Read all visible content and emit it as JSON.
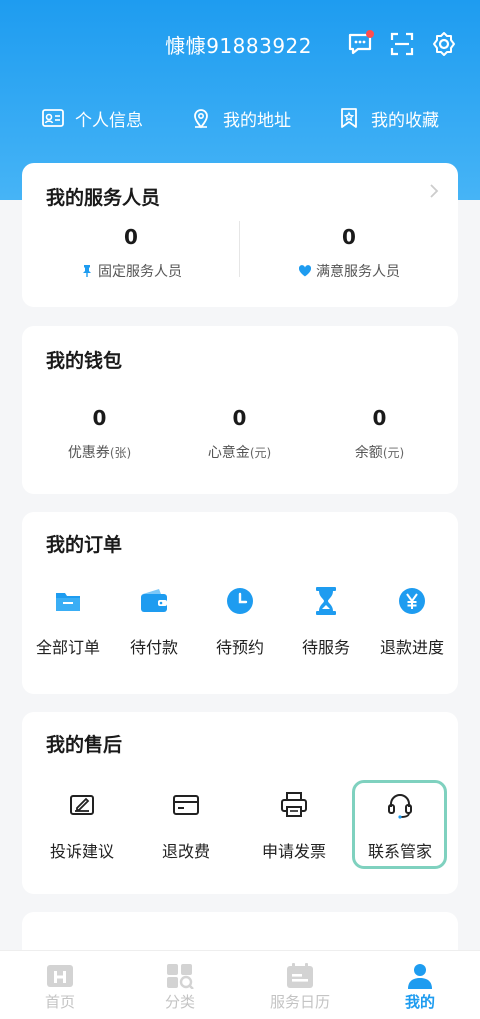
{
  "user": {
    "name": "慷慷91883922"
  },
  "topbar": {
    "message_icon": "message-icon",
    "scan_icon": "scan-icon",
    "settings_icon": "gear-icon"
  },
  "quick_links": [
    {
      "label": "个人信息",
      "icon": "id-card-icon"
    },
    {
      "label": "我的地址",
      "icon": "location-pin-icon"
    },
    {
      "label": "我的收藏",
      "icon": "bookmark-star-icon"
    }
  ],
  "staff": {
    "title": "我的服务人员",
    "fixed": {
      "count": "0",
      "label": "固定服务人员"
    },
    "satisfied": {
      "count": "0",
      "label": "满意服务人员"
    }
  },
  "wallet": {
    "title": "我的钱包",
    "items": [
      {
        "value": "0",
        "label": "优惠券",
        "unit": "(张)"
      },
      {
        "value": "0",
        "label": "心意金",
        "unit": "(元)"
      },
      {
        "value": "0",
        "label": "余额",
        "unit": "(元)"
      }
    ]
  },
  "orders": {
    "title": "我的订单",
    "items": [
      {
        "label": "全部订单",
        "icon": "folder-icon"
      },
      {
        "label": "待付款",
        "icon": "wallet-icon"
      },
      {
        "label": "待预约",
        "icon": "clock-icon"
      },
      {
        "label": "待服务",
        "icon": "hourglass-icon"
      },
      {
        "label": "退款进度",
        "icon": "yuan-icon"
      }
    ]
  },
  "aftersale": {
    "title": "我的售后",
    "items": [
      {
        "label": "投诉建议",
        "icon": "edit-icon"
      },
      {
        "label": "退改费",
        "icon": "card-icon"
      },
      {
        "label": "申请发票",
        "icon": "printer-icon"
      },
      {
        "label": "联系管家",
        "icon": "headset-icon"
      }
    ]
  },
  "tabs": [
    {
      "label": "首页",
      "icon": "home-icon"
    },
    {
      "label": "分类",
      "icon": "category-icon"
    },
    {
      "label": "服务日历",
      "icon": "calendar-icon"
    },
    {
      "label": "我的",
      "icon": "user-icon",
      "active": true
    }
  ],
  "colors": {
    "primary": "#1e9cf0",
    "highlight_border": "#7fd1bf",
    "badge": "#ff4d4f"
  }
}
